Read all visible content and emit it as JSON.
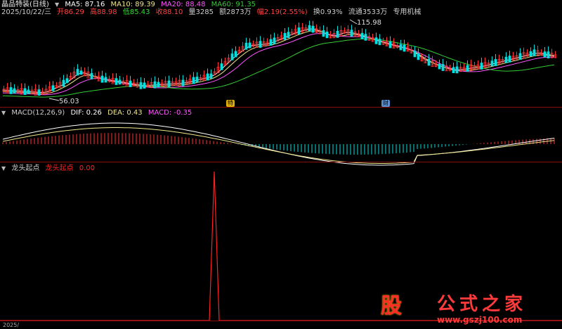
{
  "header": {
    "stock_name": "晶品特装(日线)",
    "ma5": "MA5: 87.16",
    "ma10": "MA10: 89.39",
    "ma20": "MA20: 88.48",
    "ma60": "MA60: 91.35",
    "date": "2025/10/22/三",
    "open": "开86.29",
    "high": "高88.98",
    "low": "低85.43",
    "close": "收88.10",
    "volume": "量3285",
    "amount": "额2873万",
    "change": "幅2.19(2.55%)",
    "turnover": "换0.93%",
    "float_shares": "流通3533万",
    "sector": "专用机械"
  },
  "price_chart": {
    "high_label": "115.98",
    "low_label": "56.03",
    "marker_1": "特",
    "marker_2": "财"
  },
  "macd_panel": {
    "title": "MACD(12,26,9)",
    "dif": "DIF: 0.26",
    "dea": "DEA: 0.43",
    "macd": "MACD: -0.35"
  },
  "signal_panel": {
    "title": "龙头起点",
    "legend_name": "龙头起点",
    "value": "0.00"
  },
  "watermark": {
    "logo": "股",
    "name": "公式之家",
    "url": "www.gszj100.com"
  },
  "bottom_label": "2025/",
  "colors": {
    "ma5": "#ffffff",
    "ma10": "#f0e68c",
    "ma20": "#ff55ff",
    "ma60": "#33cc33",
    "up": "#ff3333",
    "down": "#00e0e0",
    "signal": "#ff2020"
  }
}
